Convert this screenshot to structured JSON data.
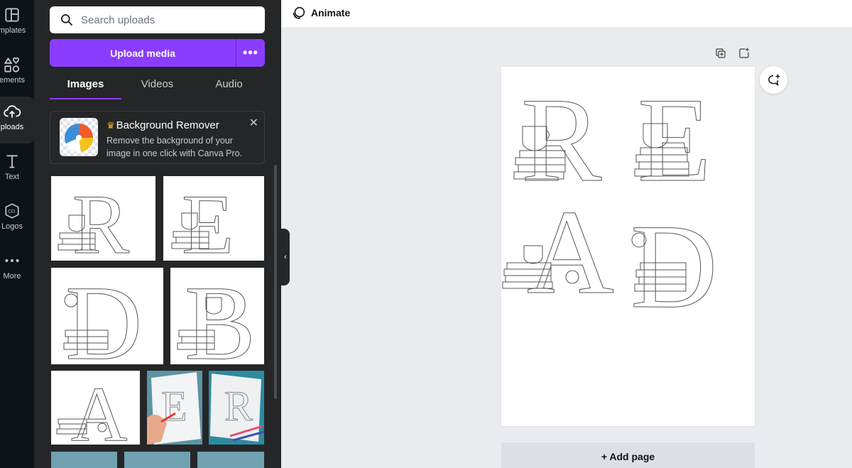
{
  "rail": {
    "items": [
      {
        "label": "mplates",
        "icon": "templates-icon"
      },
      {
        "label": "ements",
        "icon": "elements-icon"
      },
      {
        "label": "ploads",
        "icon": "uploads-icon"
      },
      {
        "label": "Text",
        "icon": "text-icon"
      },
      {
        "label": "Logos",
        "icon": "logos-icon"
      },
      {
        "label": "More",
        "icon": "more-icon"
      }
    ]
  },
  "panel": {
    "search_placeholder": "Search uploads",
    "upload_label": "Upload media",
    "more_label": "•••",
    "tabs": [
      {
        "label": "Images",
        "active": true
      },
      {
        "label": "Videos",
        "active": false
      },
      {
        "label": "Audio",
        "active": false
      }
    ],
    "promo": {
      "title": "Background Remover",
      "text": "Remove the background of your image in one click with Canva Pro.",
      "close": "✕"
    },
    "thumbnails": [
      {
        "letter": "R"
      },
      {
        "letter": "E"
      },
      {
        "letter": "D"
      },
      {
        "letter": "B"
      },
      {
        "letter": "A"
      },
      {
        "letter": "E"
      },
      {
        "letter": "R"
      }
    ]
  },
  "topbar": {
    "animate_label": "Animate"
  },
  "canvas": {
    "letters": [
      "R",
      "E",
      "A",
      "D"
    ],
    "add_page_label": "+ Add page"
  },
  "colors": {
    "accent": "#8b3dff",
    "rail_bg": "#0e1318",
    "panel_bg": "#252627",
    "canvas_bg": "#e9ebee"
  }
}
